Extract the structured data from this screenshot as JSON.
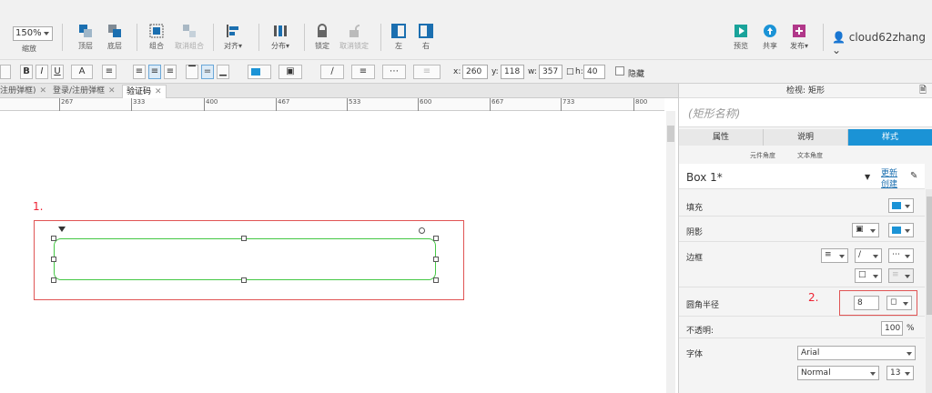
{
  "toolbar": {
    "zoom_value": "150%",
    "zoom_label": "缩放",
    "buttons": {
      "top": "顶层",
      "bottom": "底层",
      "group": "组合",
      "ungroup": "取消组合",
      "align": "对齐▾",
      "distribute": "分布▾",
      "lock": "锁定",
      "unlock": "取消锁定",
      "left": "左",
      "right": "右",
      "preview": "预览",
      "share": "共享",
      "publish": "发布▾"
    },
    "user": "cloud62zhang"
  },
  "format_bar": {
    "bold": "B",
    "italic": "I",
    "underline": "U",
    "font_color": "A",
    "x_label": "x:",
    "x": "260",
    "y_label": "y:",
    "y": "118",
    "w_label": "w:",
    "w": "357",
    "h_label": "h:",
    "h": "40",
    "hidden_label": "隐藏"
  },
  "tabs": [
    {
      "label": "注册弹框)"
    },
    {
      "label": "登录/注册弹框"
    },
    {
      "label": "验证码"
    }
  ],
  "ruler_labels": [
    "267",
    "333",
    "400",
    "467",
    "533",
    "600",
    "667",
    "733",
    "800"
  ],
  "canvas": {
    "annotation_1": "1.",
    "annotation_2": "2."
  },
  "panel": {
    "title": "检视: 矩形",
    "shape_name_placeholder": "(矩形名称)",
    "tabs": [
      "属性",
      "说明",
      "样式"
    ],
    "small_labels": [
      "元件角度",
      "文本角度"
    ],
    "style_name": "Box 1*",
    "update": "更新",
    "create": "创建",
    "fill_label": "填充",
    "shadow_label": "阴影",
    "border_label": "边框",
    "radius_label": "圆角半径",
    "radius_value": "8",
    "opacity_label": "不透明:",
    "opacity_value": "100",
    "opacity_unit": "%",
    "font_label": "字体",
    "font_family": "Arial",
    "font_weight": "Normal",
    "font_size": "13",
    "accent": "#1b93d6"
  }
}
